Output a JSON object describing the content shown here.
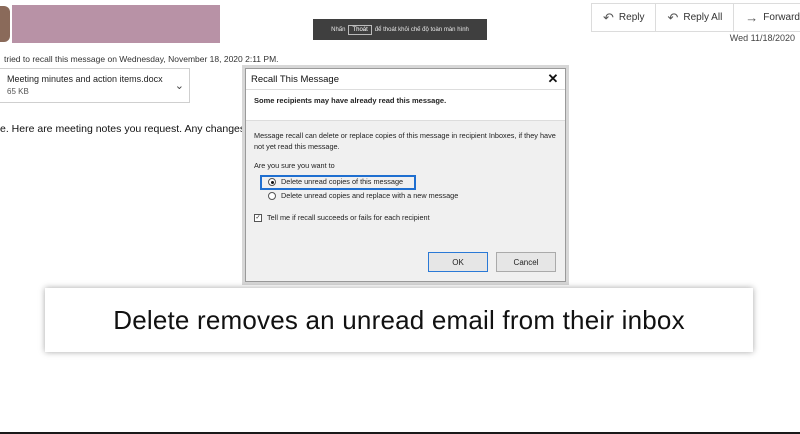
{
  "fullscreen_banner": {
    "prefix": "Nhấn",
    "key": "Thoát",
    "suffix": "để thoát khỏi chế độ toàn màn hình"
  },
  "toolbar": {
    "reply": "Reply",
    "reply_all": "Reply All",
    "forward": "Forward",
    "icons": {
      "reply": "reply-arrow-icon",
      "reply_all": "reply-all-arrow-icon",
      "forward": "forward-arrow-icon"
    }
  },
  "message": {
    "date": "Wed 11/18/2020",
    "recall_info": "tried to recall this message on Wednesday, November 18, 2020 2:11 PM.",
    "attachment": {
      "name": "Meeting minutes and action items.docx",
      "size": "65 KB"
    },
    "body": "e. Here are meeting notes you request. Any changes,"
  },
  "dialog": {
    "title": "Recall This Message",
    "warning": "Some recipients may have already read this message.",
    "description": "Message recall can delete or replace copies of this message in recipient Inboxes, if they have not yet read this message.",
    "question": "Are you sure you want to",
    "options": [
      {
        "label": "Delete unread copies of this message",
        "selected": true
      },
      {
        "label": "Delete unread copies and replace with a new message",
        "selected": false
      }
    ],
    "notify_label": "Tell me if recall succeeds or fails for each recipient",
    "notify_checked": true,
    "ok": "OK",
    "cancel": "Cancel"
  },
  "caption": "Delete removes an unread email from their inbox",
  "colors": {
    "selection_border": "#1f6fd0",
    "banner_bg": "#3f3f3f"
  }
}
